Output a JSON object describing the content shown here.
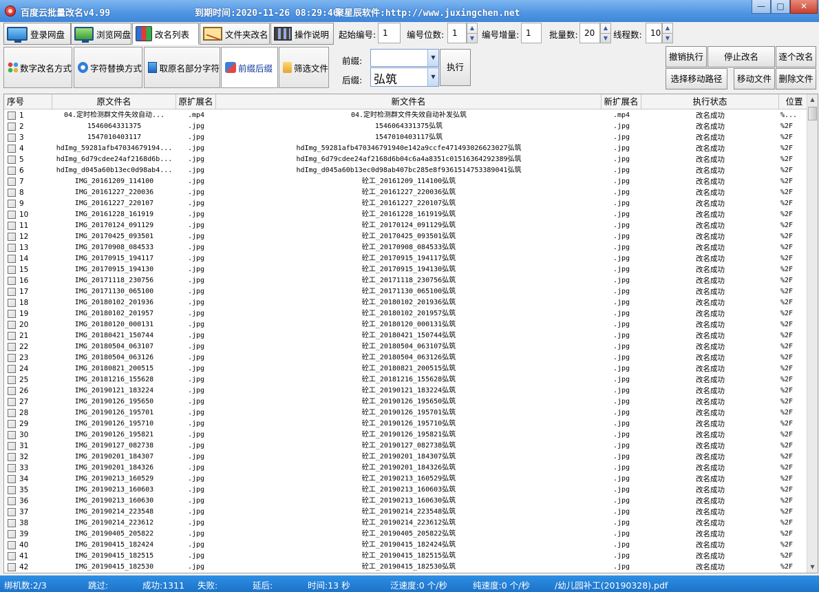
{
  "titlebar": {
    "app_title": "百度云批量改名v4.99",
    "expiry": "到期时间:2020-11-26 08:29:46",
    "vendor": "聚星辰软件:http://www.juxingchen.net",
    "min_glyph": "—",
    "max_glyph": "□",
    "close_glyph": "✕"
  },
  "tabs": [
    "登录网盘",
    "浏览网盘",
    "改名列表",
    "文件夹改名",
    "操作说明"
  ],
  "params": {
    "start_label": "起始编号:",
    "start_value": "1",
    "digits_label": "编号位数:",
    "digits_value": "1",
    "increment_label": "编号增量:",
    "increment_value": "1",
    "batch_label": "批量数:",
    "batch_value": "20",
    "threads_label": "线程数:",
    "threads_value": "10"
  },
  "modes": [
    "数字改名方式",
    "字符替换方式",
    "取原名部分字符",
    "前缀后缀",
    "筛选文件"
  ],
  "affix": {
    "prefix_label": "前缀:",
    "prefix_value": "",
    "suffix_label": "后缀:",
    "suffix_value": "弘筑",
    "execute_label": "执行"
  },
  "actions": {
    "undo": "撤销执行",
    "stop": "停止改名",
    "one_by_one": "逐个改名",
    "move_path": "选择移动路径",
    "move_files": "移动文件",
    "delete_files": "删除文件"
  },
  "table": {
    "headers": [
      "序号",
      "原文件名",
      "原扩展名",
      "新文件名",
      "新扩展名",
      "执行状态",
      "位置"
    ],
    "rows": [
      [
        "1",
        "04.定时检测群文件失效自动...",
        ".mp4",
        "04.定时检测群文件失效自动补发弘筑",
        ".mp4",
        "改名成功",
        "%..."
      ],
      [
        "2",
        "1546064331375",
        ".jpg",
        "1546064331375弘筑",
        ".jpg",
        "改名成功",
        "%2F"
      ],
      [
        "3",
        "1547010403117",
        ".jpg",
        "1547010403117弘筑",
        ".jpg",
        "改名成功",
        "%2F"
      ],
      [
        "4",
        "hdImg_59281afb47034679194...",
        ".jpg",
        "hdImg_59281afb470346791940e142a9ccfe471493026623027弘筑",
        ".jpg",
        "改名成功",
        "%2F"
      ],
      [
        "5",
        "hdImg_6d79cdee24af2168d6b...",
        ".jpg",
        "hdImg_6d79cdee24af2168d6b04c6a4a8351c01516364292389弘筑",
        ".jpg",
        "改名成功",
        "%2F"
      ],
      [
        "6",
        "hdImg_d045a60b13ec0d98ab4...",
        ".jpg",
        "hdImg_d045a60b13ec0d98ab407bc285e8f9361514753389041弘筑",
        ".jpg",
        "改名成功",
        "%2F"
      ],
      [
        "7",
        "IMG_20161209_114100",
        ".jpg",
        "砼工_20161209_114100弘筑",
        ".jpg",
        "改名成功",
        "%2F"
      ],
      [
        "8",
        "IMG_20161227_220036",
        ".jpg",
        "砼工_20161227_220036弘筑",
        ".jpg",
        "改名成功",
        "%2F"
      ],
      [
        "9",
        "IMG_20161227_220107",
        ".jpg",
        "砼工_20161227_220107弘筑",
        ".jpg",
        "改名成功",
        "%2F"
      ],
      [
        "10",
        "IMG_20161228_161919",
        ".jpg",
        "砼工_20161228_161919弘筑",
        ".jpg",
        "改名成功",
        "%2F"
      ],
      [
        "11",
        "IMG_20170124_091129",
        ".jpg",
        "砼工_20170124_091129弘筑",
        ".jpg",
        "改名成功",
        "%2F"
      ],
      [
        "12",
        "IMG_20170425_093501",
        ".jpg",
        "砼工_20170425_093501弘筑",
        ".jpg",
        "改名成功",
        "%2F"
      ],
      [
        "13",
        "IMG_20170908_084533",
        ".jpg",
        "砼工_20170908_084533弘筑",
        ".jpg",
        "改名成功",
        "%2F"
      ],
      [
        "14",
        "IMG_20170915_194117",
        ".jpg",
        "砼工_20170915_194117弘筑",
        ".jpg",
        "改名成功",
        "%2F"
      ],
      [
        "15",
        "IMG_20170915_194130",
        ".jpg",
        "砼工_20170915_194130弘筑",
        ".jpg",
        "改名成功",
        "%2F"
      ],
      [
        "16",
        "IMG_20171118_230756",
        ".jpg",
        "砼工_20171118_230756弘筑",
        ".jpg",
        "改名成功",
        "%2F"
      ],
      [
        "17",
        "IMG_20171130_065100",
        ".jpg",
        "砼工_20171130_065100弘筑",
        ".jpg",
        "改名成功",
        "%2F"
      ],
      [
        "18",
        "IMG_20180102_201936",
        ".jpg",
        "砼工_20180102_201936弘筑",
        ".jpg",
        "改名成功",
        "%2F"
      ],
      [
        "19",
        "IMG_20180102_201957",
        ".jpg",
        "砼工_20180102_201957弘筑",
        ".jpg",
        "改名成功",
        "%2F"
      ],
      [
        "20",
        "IMG_20180120_000131",
        ".jpg",
        "砼工_20180120_000131弘筑",
        ".jpg",
        "改名成功",
        "%2F"
      ],
      [
        "21",
        "IMG_20180421_150744",
        ".jpg",
        "砼工_20180421_150744弘筑",
        ".jpg",
        "改名成功",
        "%2F"
      ],
      [
        "22",
        "IMG_20180504_063107",
        ".jpg",
        "砼工_20180504_063107弘筑",
        ".jpg",
        "改名成功",
        "%2F"
      ],
      [
        "23",
        "IMG_20180504_063126",
        ".jpg",
        "砼工_20180504_063126弘筑",
        ".jpg",
        "改名成功",
        "%2F"
      ],
      [
        "24",
        "IMG_20180821_200515",
        ".jpg",
        "砼工_20180821_200515弘筑",
        ".jpg",
        "改名成功",
        "%2F"
      ],
      [
        "25",
        "IMG_20181216_155628",
        ".jpg",
        "砼工_20181216_155628弘筑",
        ".jpg",
        "改名成功",
        "%2F"
      ],
      [
        "26",
        "IMG_20190121_183224",
        ".jpg",
        "砼工_20190121_183224弘筑",
        ".jpg",
        "改名成功",
        "%2F"
      ],
      [
        "27",
        "IMG_20190126_195650",
        ".jpg",
        "砼工_20190126_195650弘筑",
        ".jpg",
        "改名成功",
        "%2F"
      ],
      [
        "28",
        "IMG_20190126_195701",
        ".jpg",
        "砼工_20190126_195701弘筑",
        ".jpg",
        "改名成功",
        "%2F"
      ],
      [
        "29",
        "IMG_20190126_195710",
        ".jpg",
        "砼工_20190126_195710弘筑",
        ".jpg",
        "改名成功",
        "%2F"
      ],
      [
        "30",
        "IMG_20190126_195821",
        ".jpg",
        "砼工_20190126_195821弘筑",
        ".jpg",
        "改名成功",
        "%2F"
      ],
      [
        "31",
        "IMG_20190127_082738",
        ".jpg",
        "砼工_20190127_082738弘筑",
        ".jpg",
        "改名成功",
        "%2F"
      ],
      [
        "32",
        "IMG_20190201_184307",
        ".jpg",
        "砼工_20190201_184307弘筑",
        ".jpg",
        "改名成功",
        "%2F"
      ],
      [
        "33",
        "IMG_20190201_184326",
        ".jpg",
        "砼工_20190201_184326弘筑",
        ".jpg",
        "改名成功",
        "%2F"
      ],
      [
        "34",
        "IMG_20190213_160529",
        ".jpg",
        "砼工_20190213_160529弘筑",
        ".jpg",
        "改名成功",
        "%2F"
      ],
      [
        "35",
        "IMG_20190213_160603",
        ".jpg",
        "砼工_20190213_160603弘筑",
        ".jpg",
        "改名成功",
        "%2F"
      ],
      [
        "36",
        "IMG_20190213_160630",
        ".jpg",
        "砼工_20190213_160630弘筑",
        ".jpg",
        "改名成功",
        "%2F"
      ],
      [
        "37",
        "IMG_20190214_223548",
        ".jpg",
        "砼工_20190214_223548弘筑",
        ".jpg",
        "改名成功",
        "%2F"
      ],
      [
        "38",
        "IMG_20190214_223612",
        ".jpg",
        "砼工_20190214_223612弘筑",
        ".jpg",
        "改名成功",
        "%2F"
      ],
      [
        "39",
        "IMG_20190405_205822",
        ".jpg",
        "砼工_20190405_205822弘筑",
        ".jpg",
        "改名成功",
        "%2F"
      ],
      [
        "40",
        "IMG_20190415_182424",
        ".jpg",
        "砼工_20190415_182424弘筑",
        ".jpg",
        "改名成功",
        "%2F"
      ],
      [
        "41",
        "IMG_20190415_182515",
        ".jpg",
        "砼工_20190415_182515弘筑",
        ".jpg",
        "改名成功",
        "%2F"
      ],
      [
        "42",
        "IMG_20190415_182530",
        ".jpg",
        "砼工_20190415_182530弘筑",
        ".jpg",
        "改名成功",
        "%2F"
      ]
    ]
  },
  "status": {
    "machines": "绑机数:2/3",
    "skipped": "跳过:",
    "success": "成功:1311",
    "failed": "失败:",
    "delay": "延后:",
    "time": "时间:13 秒",
    "gross_speed": "泛速度:0 个/秒",
    "net_speed": "纯速度:0 个/秒",
    "current_file": "/幼儿园补工(20190328).pdf"
  },
  "colors": {
    "titlebar": "#4f95e3",
    "statusbar": "#1d73c8",
    "accent": "#143a9a"
  }
}
